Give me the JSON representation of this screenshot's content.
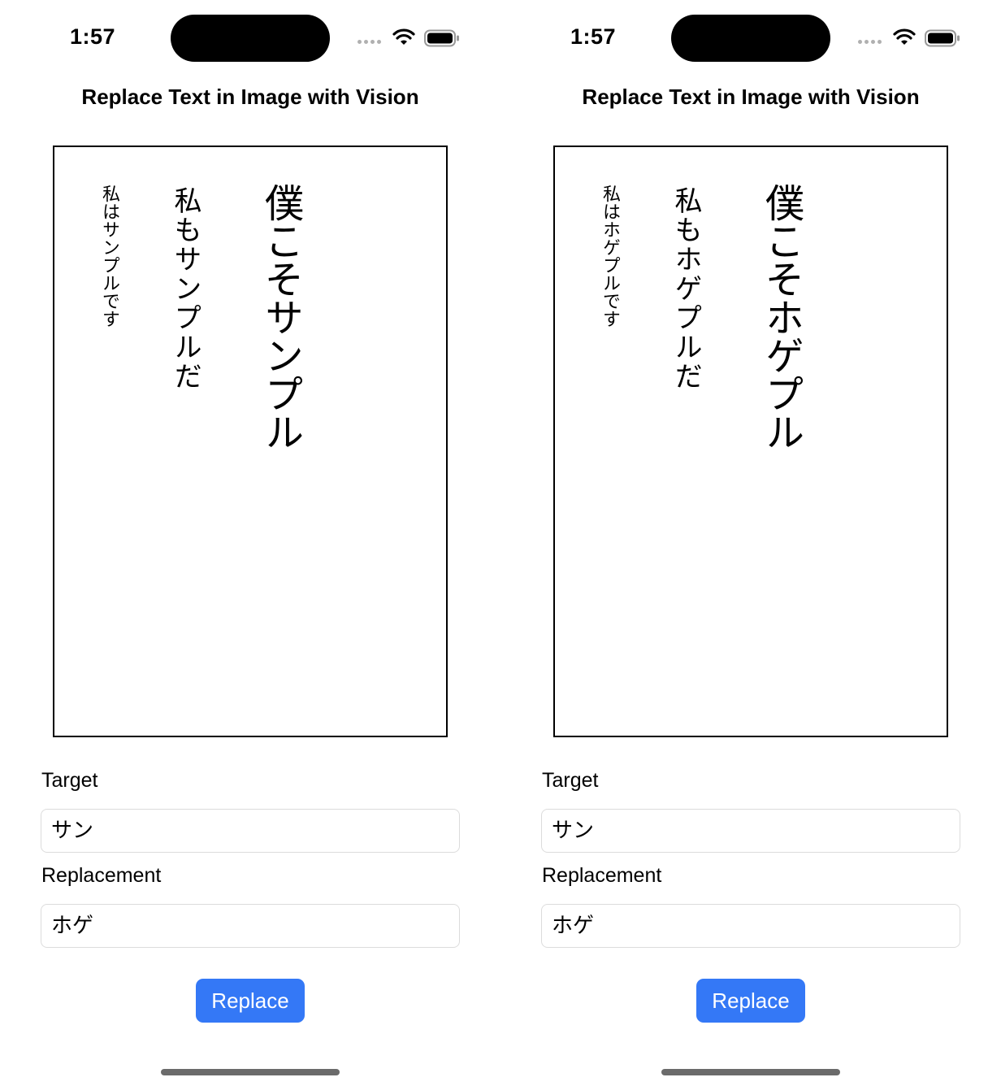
{
  "screens": [
    {
      "status": {
        "time": "1:57"
      },
      "title": "Replace Text in Image with Vision",
      "image_lines": [
        "僕こそサンプル",
        "私もサンプルだ",
        "私はサンプルです"
      ],
      "target": {
        "label": "Target",
        "value": "サン"
      },
      "replacement": {
        "label": "Replacement",
        "value": "ホゲ"
      },
      "button": "Replace"
    },
    {
      "status": {
        "time": "1:57"
      },
      "title": "Replace Text in Image with Vision",
      "image_lines": [
        "僕こそホゲプル",
        "私もホゲプルだ",
        "私はホゲプルです"
      ],
      "target": {
        "label": "Target",
        "value": "サン"
      },
      "replacement": {
        "label": "Replacement",
        "value": "ホゲ"
      },
      "button": "Replace"
    }
  ],
  "colors": {
    "accent": "#3478f6",
    "field_border": "#dcdcdc"
  },
  "icons": [
    "cellular-signal-icon",
    "wifi-icon",
    "battery-icon"
  ]
}
